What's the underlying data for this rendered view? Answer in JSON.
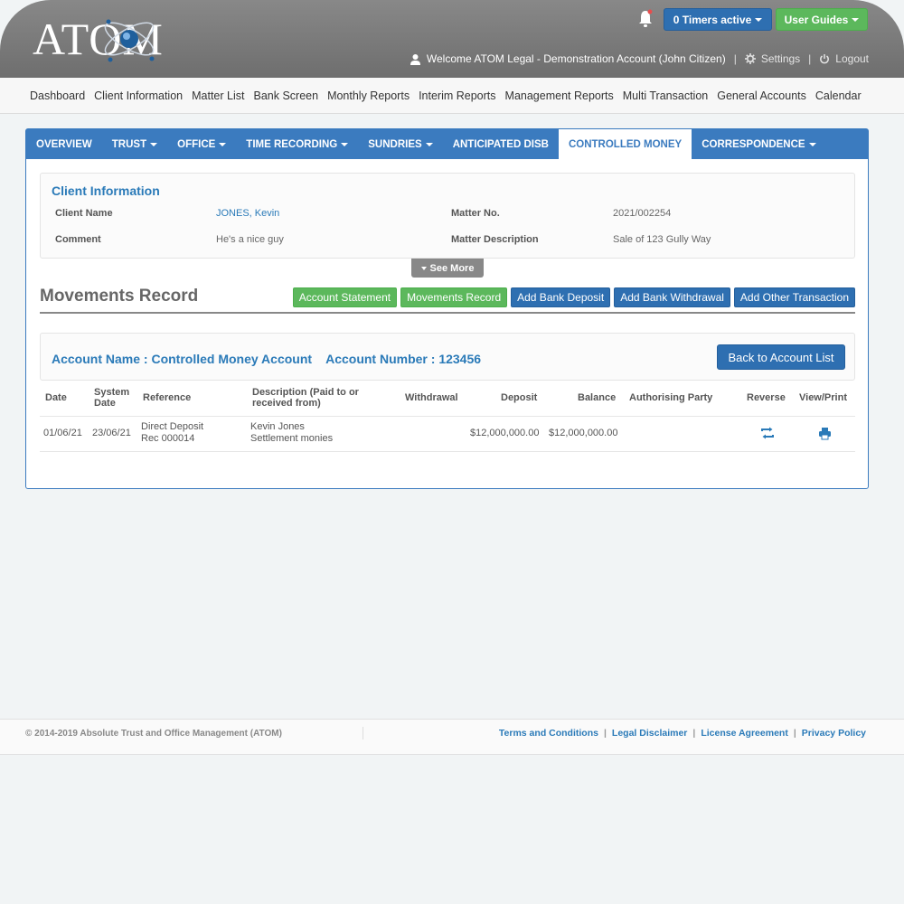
{
  "header": {
    "logo_text": "ATOM",
    "timers_label": "0 Timers active",
    "guides_label": "User Guides",
    "welcome": "Welcome ATOM Legal - Demonstration Account (John Citizen)",
    "settings": "Settings",
    "logout": "Logout"
  },
  "topnav": [
    "Dashboard",
    "Client Information",
    "Matter List",
    "Bank Screen",
    "Monthly Reports",
    "Interim Reports",
    "Management Reports",
    "Multi Transaction",
    "General Accounts",
    "Calendar"
  ],
  "tabs": [
    {
      "label": "OVERVIEW"
    },
    {
      "label": "TRUST"
    },
    {
      "label": "OFFICE"
    },
    {
      "label": "TIME RECORDING"
    },
    {
      "label": "SUNDRIES"
    },
    {
      "label": "ANTICIPATED DISB"
    },
    {
      "label": "CONTROLLED MONEY"
    },
    {
      "label": "CORRESPONDENCE"
    }
  ],
  "client": {
    "title": "Client Information",
    "client_name_label": "Client Name",
    "client_name": "JONES, Kevin",
    "comment_label": "Comment",
    "comment": "He's a nice guy",
    "matter_no_label": "Matter No.",
    "matter_no": "2021/002254",
    "matter_desc_label": "Matter Description",
    "matter_desc": "Sale of 123 Gully Way",
    "see_more": "See More"
  },
  "section": {
    "title": "Movements Record",
    "buttons": [
      "Account Statement",
      "Movements Record",
      "Add Bank Deposit",
      "Add Bank Withdrawal",
      "Add Other Transaction"
    ]
  },
  "account": {
    "label": "Account Name : Controlled Money Account    Account Number : 123456",
    "back": "Back to Account List"
  },
  "table": {
    "headers": {
      "date": "Date",
      "system_date_1": "System",
      "system_date_2": "Date",
      "reference": "Reference",
      "description_1": "Description (Paid to or",
      "description_2": "received from)",
      "withdrawal": "Withdrawal",
      "deposit": "Deposit",
      "balance": "Balance",
      "authorising": "Authorising Party",
      "reverse": "Reverse",
      "view": "View/Print"
    },
    "rows": [
      {
        "date": "01/06/21",
        "system_date": "23/06/21",
        "reference_1": "Direct Deposit",
        "reference_2": "Rec 000014",
        "description_1": "Kevin Jones",
        "description_2": "Settlement monies",
        "withdrawal": "",
        "deposit": "$12,000,000.00",
        "balance": "$12,000,000.00",
        "authorising": ""
      }
    ]
  },
  "footer": {
    "copyright": "© 2014-2019 Absolute Trust and Office Management (ATOM)",
    "links": [
      "Terms and Conditions",
      "Legal Disclaimer",
      "License Agreement",
      "Privacy Policy"
    ]
  },
  "colors": {
    "primary": "#3b7bbf",
    "green": "#5cb85c",
    "link": "#2a7ab8"
  }
}
